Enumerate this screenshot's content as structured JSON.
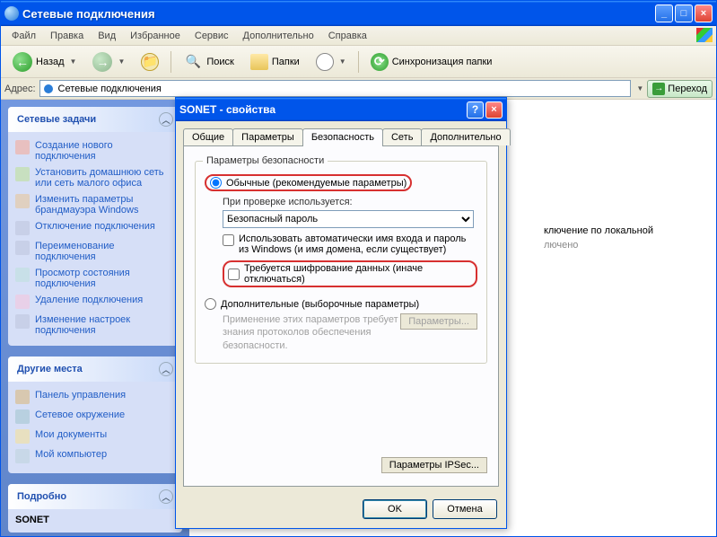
{
  "main": {
    "title": "Сетевые подключения",
    "menu": [
      "Файл",
      "Правка",
      "Вид",
      "Избранное",
      "Сервис",
      "Дополнительно",
      "Справка"
    ],
    "toolbar": {
      "back": "Назад",
      "search": "Поиск",
      "folders": "Папки",
      "sync": "Синхронизация папки"
    },
    "address": {
      "label": "Адрес:",
      "value": "Сетевые подключения",
      "go": "Переход"
    }
  },
  "sidebar": {
    "panels": [
      {
        "title": "Сетевые задачи",
        "items": [
          "Создание нового подключения",
          "Установить домашнюю сеть или сеть малого офиса",
          "Изменить параметры брандмауэра Windows",
          "Отключение подключения",
          "Переименование подключения",
          "Просмотр состояния подключения",
          "Удаление подключения",
          "Изменение настроек подключения"
        ]
      },
      {
        "title": "Другие места",
        "items": [
          "Панель управления",
          "Сетевое окружение",
          "Мои документы",
          "Мой компьютер"
        ]
      },
      {
        "title": "Подробно",
        "items": [
          "SONET"
        ]
      }
    ]
  },
  "mainarea": {
    "conn_label": "ключение по локальной",
    "conn_status": "лючено"
  },
  "dialog": {
    "title": "SONET - свойства",
    "tabs": [
      "Общие",
      "Параметры",
      "Безопасность",
      "Сеть",
      "Дополнительно"
    ],
    "active_tab": 2,
    "group_legend": "Параметры безопасности",
    "radio1": "Обычные (рекомендуемые параметры)",
    "check_label": "При проверке используется:",
    "select_value": "Безопасный пароль",
    "chk1": "Использовать автоматически имя входа и пароль из Windows (и имя домена, если существует)",
    "chk2": "Требуется шифрование данных (иначе отключаться)",
    "radio2": "Дополнительные (выборочные параметры)",
    "disabled_note": "Применение этих параметров требует знания протоколов обеспечения безопасности.",
    "param_btn": "Параметры...",
    "ipsec_btn": "Параметры IPSec...",
    "ok": "OK",
    "cancel": "Отмена"
  }
}
